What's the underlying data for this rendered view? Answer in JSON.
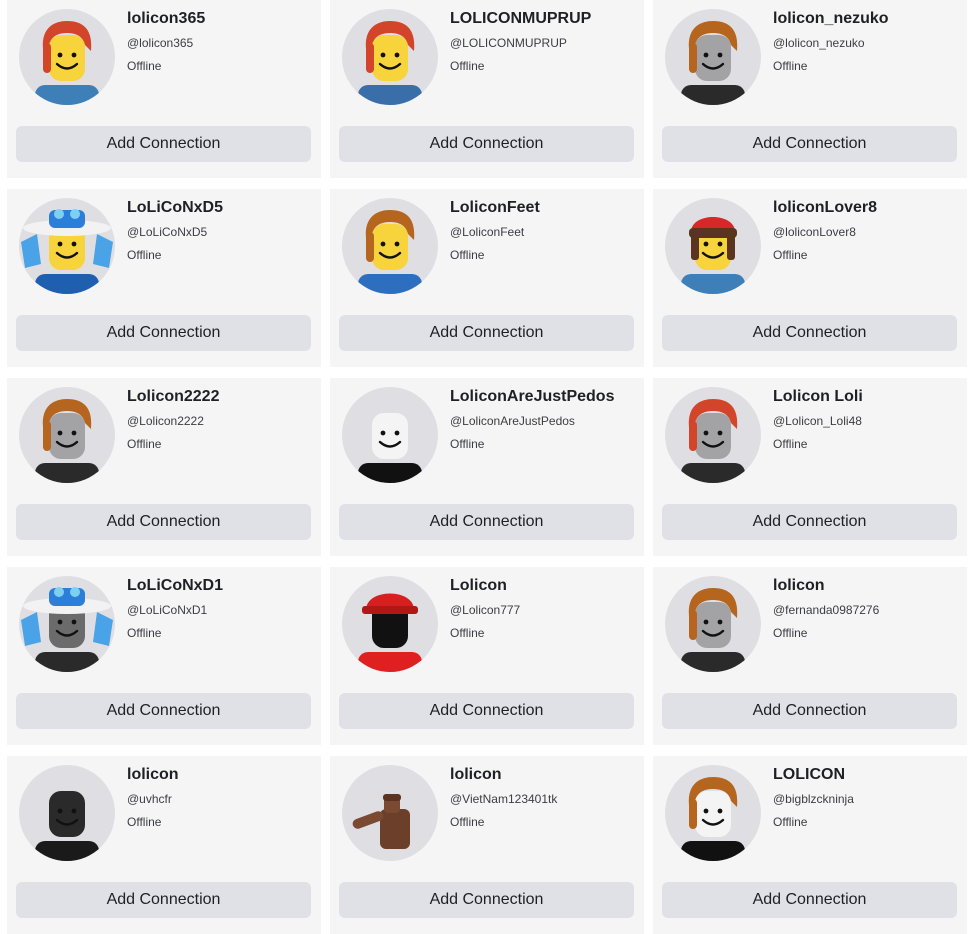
{
  "button_label": "Add Connection",
  "users": [
    {
      "name": "lolicon365",
      "handle": "@lolicon365",
      "status": "Offline",
      "avatar": "avatar-red-hair",
      "hair": "#d2452a",
      "face": "#f7d33c",
      "shirt": "#3f7fb8"
    },
    {
      "name": "LOLICONMUPRUP",
      "handle": "@LOLICONMUPRUP",
      "status": "Offline",
      "avatar": "avatar-red-hair",
      "hair": "#d2452a",
      "face": "#f7d33c",
      "shirt": "#3a6ea8"
    },
    {
      "name": "lolicon_nezuko",
      "handle": "@lolicon_nezuko",
      "status": "Offline",
      "avatar": "avatar-brown-hair",
      "hair": "#b5651d",
      "face": "#a3a2a5",
      "shirt": "#2a2a2a"
    },
    {
      "name": "LoLiCoNxD5",
      "handle": "@LoLiCoNxD5",
      "status": "Offline",
      "avatar": "avatar-blue-hat",
      "hair": "#2b7fd8",
      "face": "#f7d33c",
      "shirt": "#1f5fb0"
    },
    {
      "name": "LoliconFeet",
      "handle": "@LoliconFeet",
      "status": "Offline",
      "avatar": "avatar-brown-hair",
      "hair": "#b5651d",
      "face": "#f7d33c",
      "shirt": "#2d6fbe"
    },
    {
      "name": "loliconLover8",
      "handle": "@loliconLover8",
      "status": "Offline",
      "avatar": "avatar-red-cap",
      "hair": "#5a3420",
      "face": "#f7d33c",
      "shirt": "#3f7fb8"
    },
    {
      "name": "Lolicon2222",
      "handle": "@Lolicon2222",
      "status": "Offline",
      "avatar": "avatar-brown-hair",
      "hair": "#b5651d",
      "face": "#a3a2a5",
      "shirt": "#2a2a2a"
    },
    {
      "name": "LoliconAreJustPedos",
      "handle": "@LoliconAreJustPedos",
      "status": "Offline",
      "avatar": "avatar-bald",
      "hair": "#f4f4f4",
      "face": "#f4f4f4",
      "shirt": "#111111"
    },
    {
      "name": "Lolicon Loli",
      "handle": "@Lolicon_Loli48",
      "status": "Offline",
      "avatar": "avatar-red-hair",
      "hair": "#d2452a",
      "face": "#a3a2a5",
      "shirt": "#2a2a2a"
    },
    {
      "name": "LoLiCoNxD1",
      "handle": "@LoLiCoNxD1",
      "status": "Offline",
      "avatar": "avatar-blue-hat",
      "hair": "#2b7fd8",
      "face": "#6b6b6b",
      "shirt": "#2a2a2a"
    },
    {
      "name": "Lolicon",
      "handle": "@Lolicon777",
      "status": "Offline",
      "avatar": "avatar-roblox-cap",
      "hair": "#d62020",
      "face": "#111111",
      "shirt": "#e02020"
    },
    {
      "name": "lolicon",
      "handle": "@fernanda0987276",
      "status": "Offline",
      "avatar": "avatar-brown-hair",
      "hair": "#b5651d",
      "face": "#a3a2a5",
      "shirt": "#2a2a2a"
    },
    {
      "name": "lolicon",
      "handle": "@uvhcfr",
      "status": "Offline",
      "avatar": "avatar-dark",
      "hair": "#1a1a1a",
      "face": "#2a2a2a",
      "shirt": "#1a1a1a"
    },
    {
      "name": "lolicon",
      "handle": "@VietNam123401tk",
      "status": "Offline",
      "avatar": "avatar-figure",
      "hair": "#5a3420",
      "face": "#7a4a32",
      "shirt": "#6b3f2a"
    },
    {
      "name": "LOLICON",
      "handle": "@bigblzckninja",
      "status": "Offline",
      "avatar": "avatar-brown-hair",
      "hair": "#b5651d",
      "face": "#f4f4f4",
      "shirt": "#111111"
    }
  ]
}
